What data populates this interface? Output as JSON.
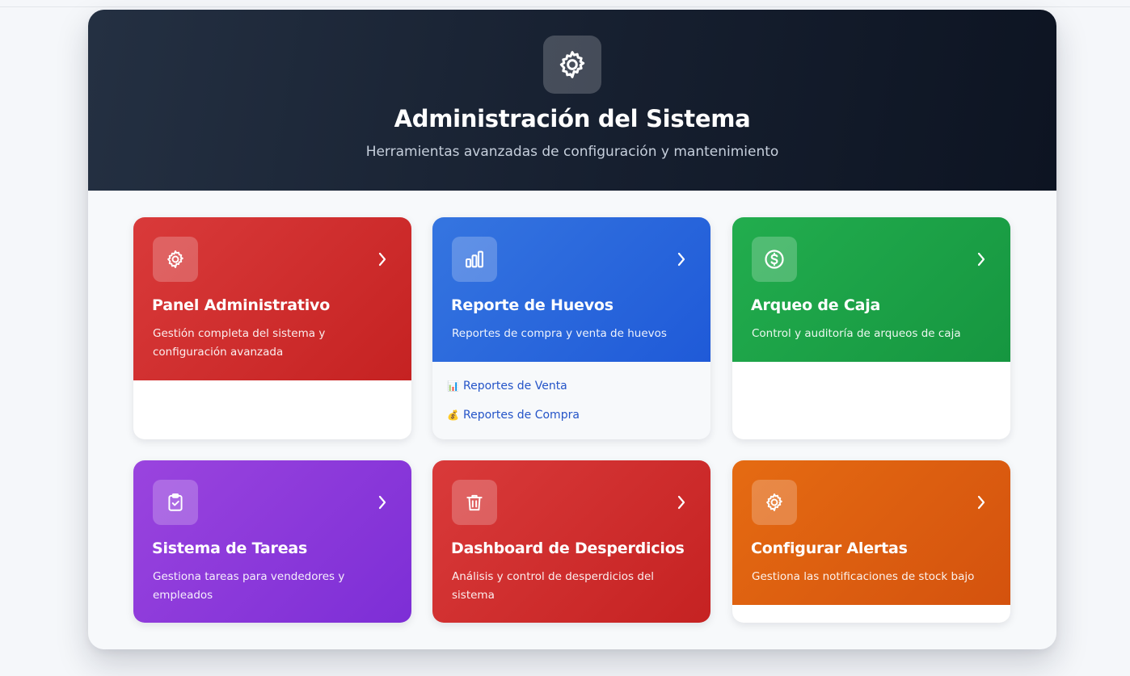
{
  "header": {
    "icon": "gear-icon",
    "title": "Administración del Sistema",
    "subtitle": "Herramientas avanzadas de configuración y mantenimiento"
  },
  "cards": [
    {
      "title": "Panel Administrativo",
      "description": "Gestión completa del sistema y configuración avanzada",
      "icon": "gear-icon",
      "color": "#d32f2f"
    },
    {
      "title": "Reporte de Huevos",
      "description": "Reportes de compra y venta de huevos",
      "icon": "bar-chart-icon",
      "color": "#2563eb",
      "links": [
        {
          "emoji": "📊",
          "label": "Reportes de Venta"
        },
        {
          "emoji": "💰",
          "label": "Reportes de Compra"
        }
      ]
    },
    {
      "title": "Arqueo de Caja",
      "description": "Control y auditoría de arqueos de caja",
      "icon": "dollar-circle-icon",
      "color": "#16a34a"
    },
    {
      "title": "Sistema de Tareas",
      "description": "Gestiona tareas para vendedores y empleados",
      "icon": "clipboard-check-icon",
      "color": "#8b3ad9"
    },
    {
      "title": "Dashboard de Desperdicios",
      "description": "Análisis y control de desperdicios del sistema",
      "icon": "trash-icon",
      "color": "#d32f2f"
    },
    {
      "title": "Configurar Alertas",
      "description": "Gestiona las notificaciones de stock bajo",
      "icon": "gear-icon",
      "color": "#e0620f"
    }
  ]
}
